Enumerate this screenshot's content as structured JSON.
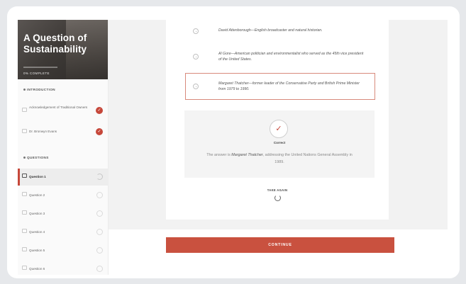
{
  "course": {
    "title": "A Question of Sustainability",
    "progress_text": "0% COMPLETE",
    "progress_fraction": 0.0
  },
  "sidebar": {
    "sections": [
      {
        "heading": "INTRODUCTION",
        "items": [
          {
            "label": "Acknowledgement of Traditional Owners",
            "status": "complete"
          },
          {
            "label": "Dr. Bronwyn Evans",
            "status": "complete"
          }
        ]
      },
      {
        "heading": "QUESTIONS",
        "items": [
          {
            "label": "Question 1",
            "status": "in-progress",
            "active": true
          },
          {
            "label": "Question 2",
            "status": "incomplete"
          },
          {
            "label": "Question 3",
            "status": "incomplete"
          },
          {
            "label": "Question 4",
            "status": "incomplete"
          },
          {
            "label": "Question 5",
            "status": "incomplete"
          },
          {
            "label": "Question 6",
            "status": "incomplete"
          }
        ]
      }
    ]
  },
  "quiz": {
    "options": [
      {
        "text": "David Attenborough—English broadcaster and natural historian.",
        "selected": false
      },
      {
        "text": "Al Gore—American politician and environmentalist who served as the 45th vice president of the United States.",
        "selected": false
      },
      {
        "text": "Margaret Thatcher—former leader of the Conservative Party and British Prime Minister from 1979 to 1990.",
        "selected": true
      }
    ],
    "feedback": {
      "title": "Correct",
      "answer_prefix": "The answer is ",
      "answer_name": "Margaret Thatcher",
      "answer_suffix": ", addressing the United Nations General Assembly in 1989."
    },
    "take_again_label": "TAKE AGAIN",
    "continue_label": "CONTINUE"
  },
  "colors": {
    "accent": "#c9513f",
    "selected_border": "#d88a7c"
  }
}
